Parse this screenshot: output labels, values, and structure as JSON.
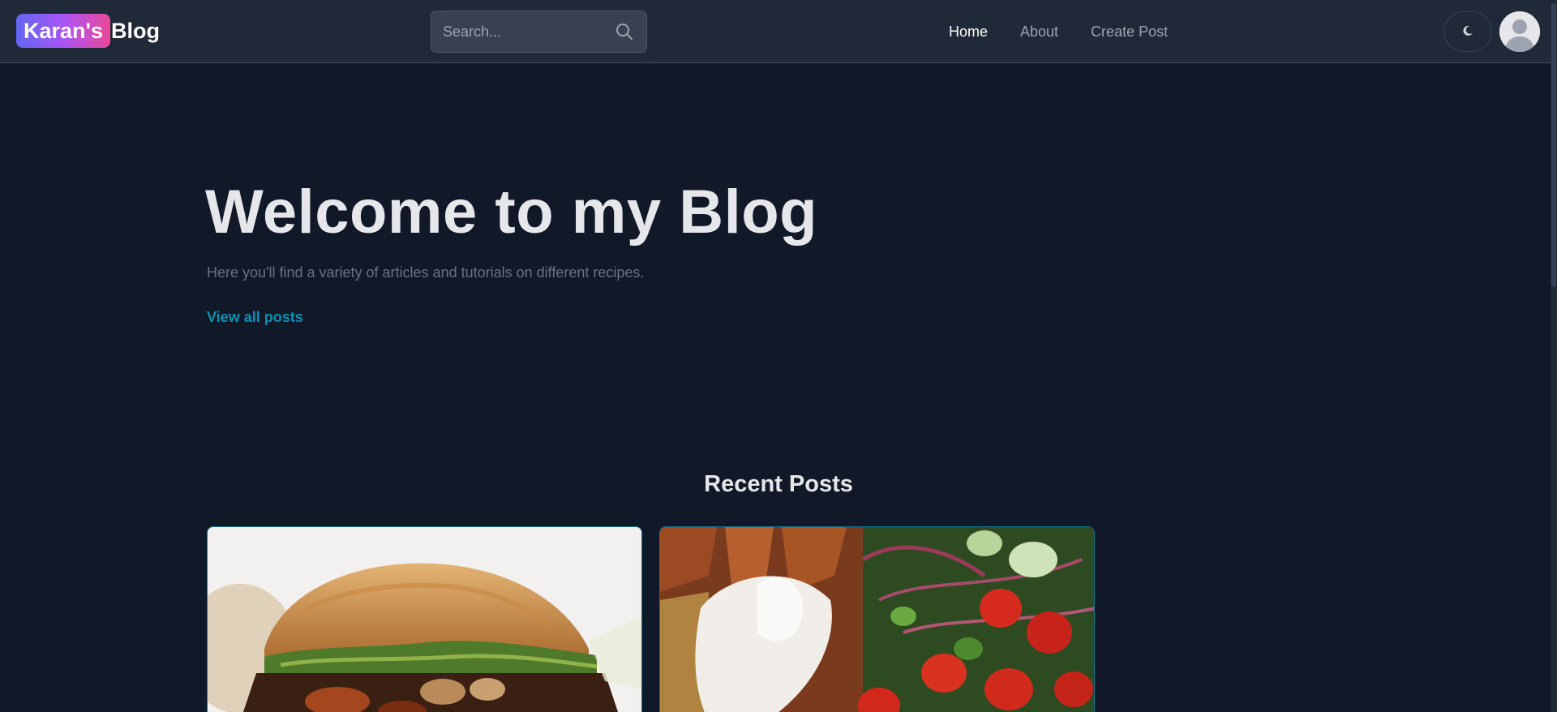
{
  "navbar": {
    "brand_badge": "Karan's",
    "brand_rest": "Blog",
    "search_placeholder": "Search...",
    "links": [
      {
        "label": "Home",
        "active": true
      },
      {
        "label": "About",
        "active": false
      },
      {
        "label": "Create Post",
        "active": false
      }
    ],
    "theme_icon": "moon-icon",
    "avatar_icon": "user-avatar-icon"
  },
  "hero": {
    "title": "Welcome to my Blog",
    "subtitle": "Here you'll find a variety of articles and tutorials on different recipes.",
    "cta": "View all posts"
  },
  "recent": {
    "title": "Recent Posts",
    "posts": [
      {
        "image": "sandwich-photo"
      },
      {
        "image": "chicken-salad-photo"
      }
    ]
  },
  "colors": {
    "background": "#111827",
    "navbar": "#1f2937",
    "accent": "#0891b2",
    "brand_gradient_start": "#6366f1",
    "brand_gradient_end": "#ec4899"
  }
}
